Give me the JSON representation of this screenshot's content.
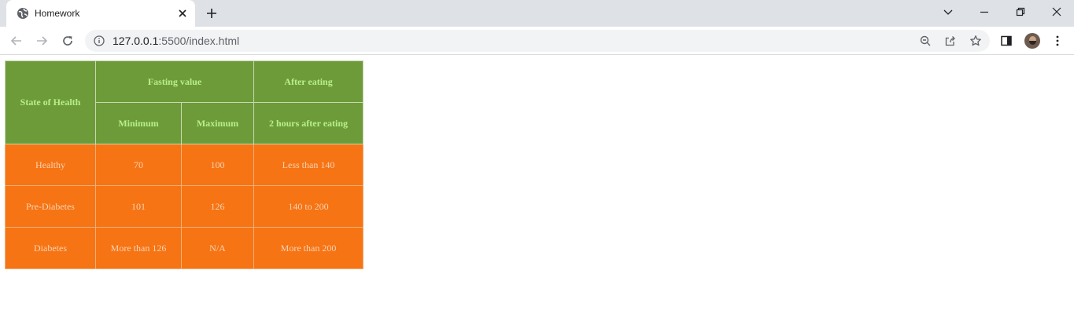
{
  "browser": {
    "tab_title": "Homework",
    "url_host": "127.0.0.1",
    "url_rest": ":5500/index.html"
  },
  "table": {
    "header": {
      "state": "State of Health",
      "fasting": "Fasting value",
      "after": "After eating",
      "minimum": "Minimum",
      "maximum": "Maximum",
      "two_hours": "2 hours after eating"
    },
    "rows": [
      [
        "Healthy",
        "70",
        "100",
        "Less than 140"
      ],
      [
        "Pre-Diabetes",
        "101",
        "126",
        "140 to 200"
      ],
      [
        "Diabetes",
        "More than 126",
        "N/A",
        "More than 200"
      ]
    ]
  },
  "colors": {
    "header_bg": "#6e9b3a",
    "header_text": "#b7f08a",
    "body_bg": "#f67414",
    "body_text": "#f8d3b2"
  }
}
